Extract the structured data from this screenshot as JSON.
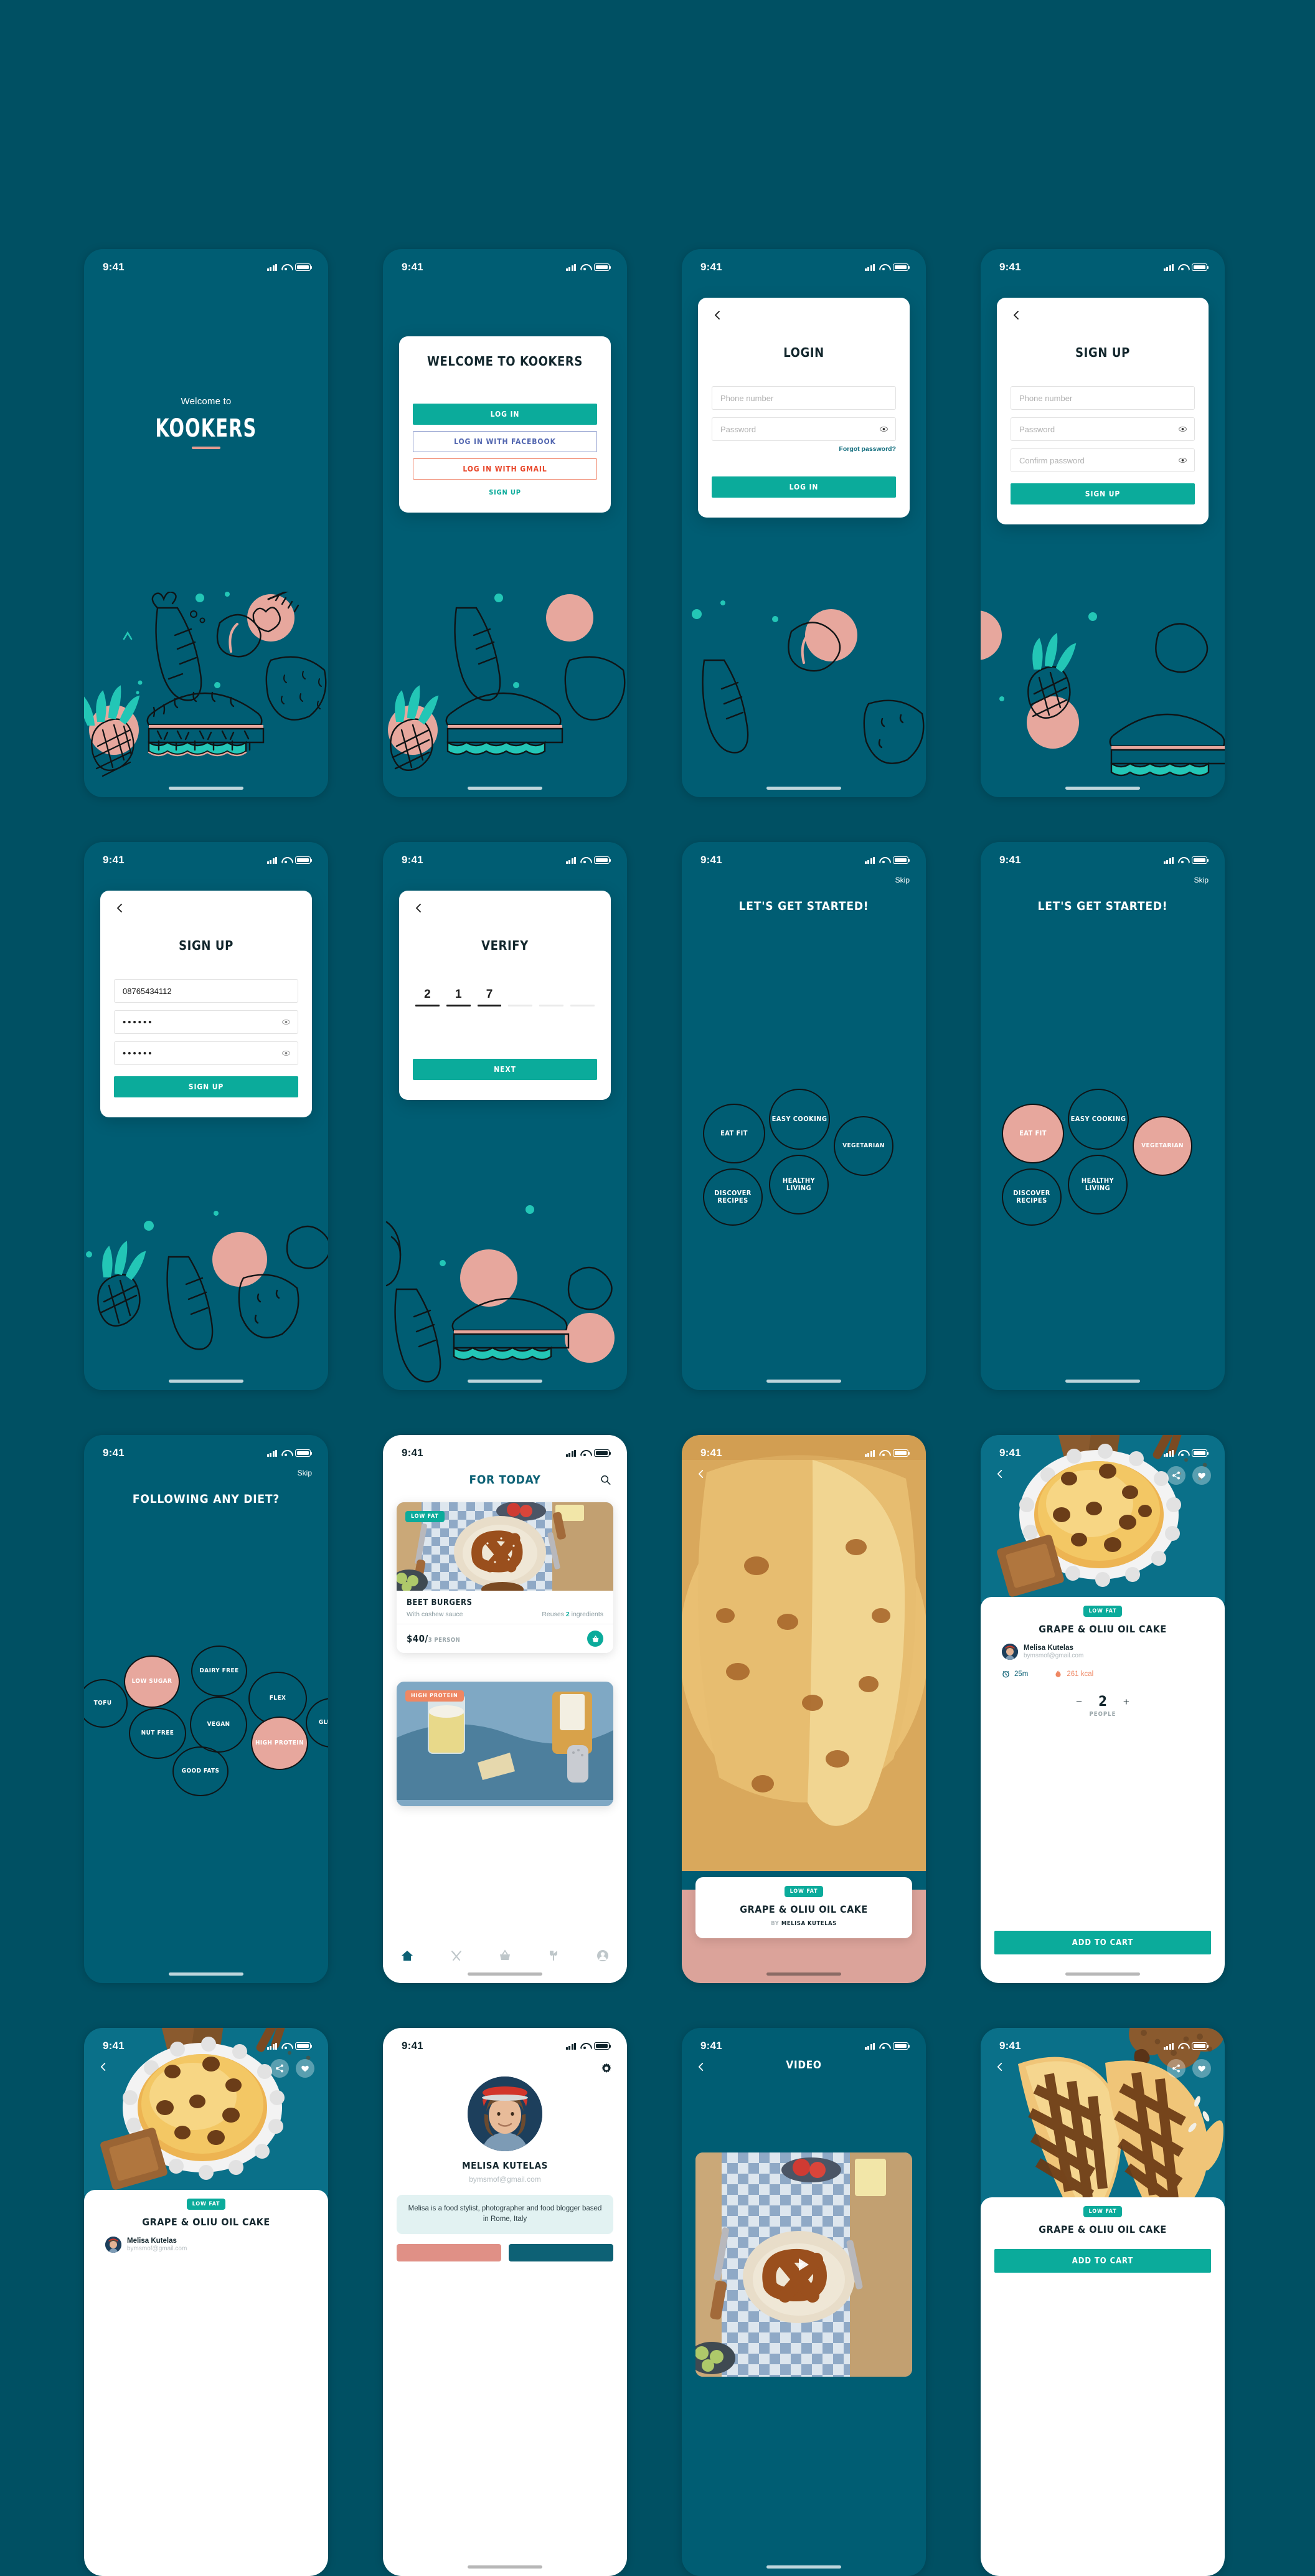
{
  "meta": {
    "kit_name": "Kookers",
    "background_color": "#005063",
    "accent_teal": "#0bab9b",
    "accent_deep_teal": "#0d6175",
    "accent_coral": "#e7a79d",
    "accent_orange": "#ef8763"
  },
  "status_bar": {
    "time": "9:41"
  },
  "screens": {
    "splash": {
      "welcome_label": "Welcome to",
      "logo": "KOOKERS"
    },
    "welcome": {
      "title": "WELCOME TO KOOKERS",
      "login_button": "LOG IN",
      "facebook_button": "LOG IN WITH FACEBOOK",
      "gmail_button": "LOG IN WITH GMAIL",
      "signup_link": "SIGN UP"
    },
    "login": {
      "title": "LOGIN",
      "phone_placeholder": "Phone number",
      "password_placeholder": "Password",
      "forgot_link": "Forgot password?",
      "submit_button": "LOG IN"
    },
    "signup_empty": {
      "title": "SIGN UP",
      "phone_placeholder": "Phone number",
      "password_placeholder": "Password",
      "confirm_placeholder": "Confirm password",
      "submit_button": "SIGN UP"
    },
    "signup_filled": {
      "title": "SIGN UP",
      "phone_value": "08765434112",
      "password_value": "••••••",
      "confirm_value": "••••••",
      "submit_button": "SIGN UP"
    },
    "verify": {
      "title": "VERIFY",
      "digits": [
        "2",
        "1",
        "7",
        "",
        "",
        ""
      ],
      "next_button": "NEXT"
    },
    "onboard_interests": {
      "skip_label": "Skip",
      "title": "LET'S GET STARTED!",
      "bubbles": [
        {
          "label": "EAT FIT",
          "selected": false
        },
        {
          "label": "EASY COOKING",
          "selected": false
        },
        {
          "label": "VEGETARIAN",
          "selected": false
        },
        {
          "label": "DISCOVER RECIPES",
          "selected": false
        },
        {
          "label": "HEALTHY LIVING",
          "selected": false
        }
      ]
    },
    "onboard_interests_selected": {
      "skip_label": "Skip",
      "title": "LET'S GET STARTED!",
      "bubbles": [
        {
          "label": "EAT FIT",
          "selected": true
        },
        {
          "label": "EASY COOKING",
          "selected": false
        },
        {
          "label": "VEGETARIAN",
          "selected": true
        },
        {
          "label": "DISCOVER RECIPES",
          "selected": false
        },
        {
          "label": "HEALTHY LIVING",
          "selected": false
        }
      ]
    },
    "onboard_diet": {
      "skip_label": "Skip",
      "title": "FOLLOWING ANY DIET?",
      "bubbles": [
        {
          "label": "TOFU",
          "selected": false
        },
        {
          "label": "LOW SUGAR",
          "selected": true
        },
        {
          "label": "DAIRY FREE",
          "selected": false
        },
        {
          "label": "FLEX",
          "selected": false
        },
        {
          "label": "GLUTEN",
          "selected": false
        },
        {
          "label": "NUT FREE",
          "selected": false
        },
        {
          "label": "VEGAN",
          "selected": false
        },
        {
          "label": "HIGH PROTEIN",
          "selected": true
        },
        {
          "label": "GOOD FATS",
          "selected": false
        }
      ]
    },
    "for_today": {
      "title": "FOR TODAY",
      "search_icon": "search-icon",
      "cards": [
        {
          "tag": "LOW FAT",
          "tag_color": "#0bab9b",
          "name": "BEET BURGERS",
          "subtitle": "With cashew sauce",
          "reuses_prefix": "Reuses ",
          "reuses_count": "2",
          "reuses_suffix": " ingredients",
          "price": "$40/",
          "servings": "3 PERSON"
        },
        {
          "tag": "HIGH PROTEIN",
          "tag_color": "#ef8763"
        }
      ],
      "tabs": [
        {
          "icon": "home-icon",
          "active": true
        },
        {
          "icon": "cutlery-icon",
          "active": false
        },
        {
          "icon": "basket-icon",
          "active": false
        },
        {
          "icon": "sprout-icon",
          "active": false
        },
        {
          "icon": "profile-icon",
          "active": false
        }
      ]
    },
    "recipe_cover": {
      "tag": "LOW FAT",
      "title": "GRAPE & OLIU OIL CAKE",
      "by_prefix": "BY ",
      "author": "MELISA KUTELAS"
    },
    "recipe_detail": {
      "tag": "LOW FAT",
      "title": "GRAPE & OLIU OIL CAKE",
      "author_name": "Melisa Kutelas",
      "author_email": "bymsmof@gmail.com",
      "time": "25m",
      "calories": "261 kcal",
      "servings_value": "2",
      "servings_label": "PEOPLE",
      "add_to_cart_button": "ADD TO CART",
      "share_icon": "share-icon",
      "like_icon": "heart-icon",
      "back_icon": "back-chevron-icon"
    },
    "profile": {
      "gear_icon": "gear-icon",
      "name": "MELISA KUTELAS",
      "email": "bymsmof@gmail.com",
      "bio": "Melisa is a food stylist, photographer and food blogger based in Rome, Italy"
    },
    "video": {
      "title": "VIDEO",
      "play_icon": "play-icon"
    },
    "recipe_detail_waffle": {
      "tag": "LOW FAT",
      "title": "GRAPE & OLIU OIL CAKE",
      "add_to_cart_button": "ADD TO CART"
    }
  }
}
